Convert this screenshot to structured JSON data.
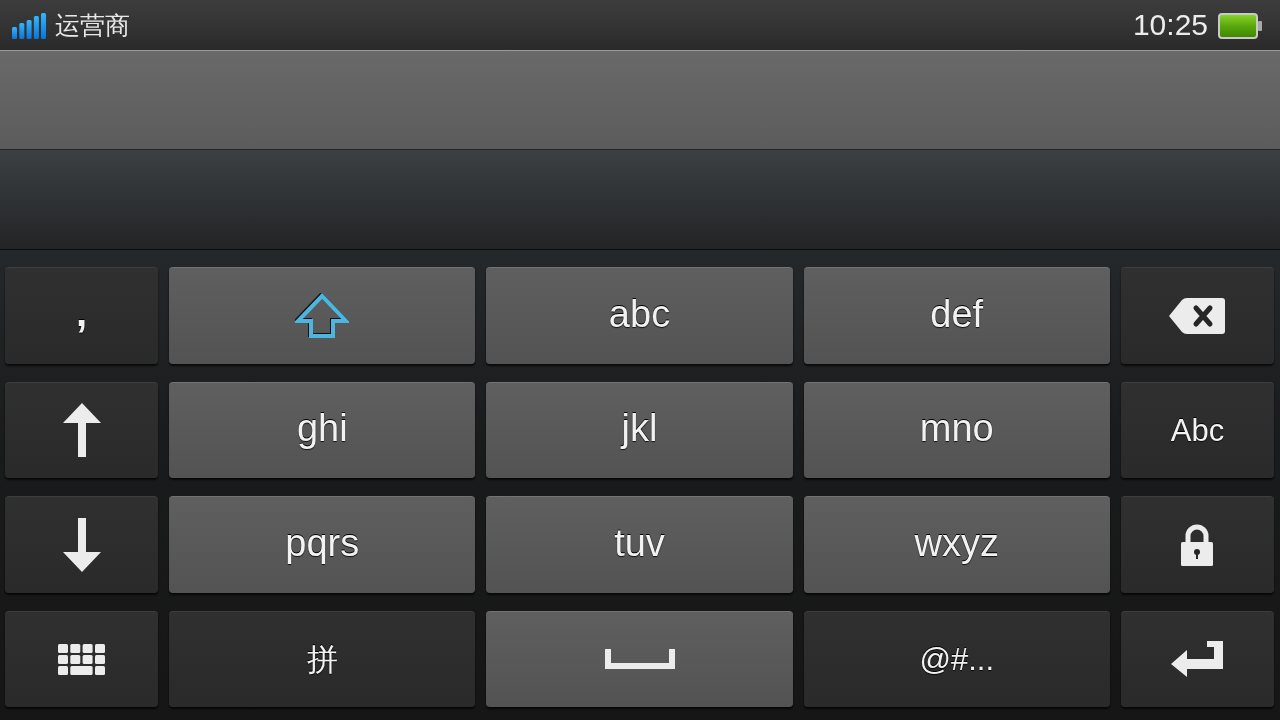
{
  "status_bar": {
    "carrier": "运营商",
    "time": "10:25"
  },
  "keyboard": {
    "rows": [
      [
        {
          "kind": "punctuation",
          "label": ","
        },
        {
          "kind": "shift"
        },
        {
          "kind": "letter",
          "label": "abc"
        },
        {
          "kind": "letter",
          "label": "def"
        },
        {
          "kind": "backspace"
        }
      ],
      [
        {
          "kind": "cursor_up"
        },
        {
          "kind": "letter",
          "label": "ghi"
        },
        {
          "kind": "letter",
          "label": "jkl"
        },
        {
          "kind": "letter",
          "label": "mno"
        },
        {
          "kind": "mode",
          "label": "Abc"
        }
      ],
      [
        {
          "kind": "cursor_down"
        },
        {
          "kind": "letter",
          "label": "pqrs"
        },
        {
          "kind": "letter",
          "label": "tuv"
        },
        {
          "kind": "letter",
          "label": "wxyz"
        },
        {
          "kind": "lock"
        }
      ],
      [
        {
          "kind": "layout"
        },
        {
          "kind": "mode",
          "label": "拼"
        },
        {
          "kind": "space"
        },
        {
          "kind": "mode",
          "label": "@#..."
        },
        {
          "kind": "enter"
        }
      ]
    ]
  }
}
